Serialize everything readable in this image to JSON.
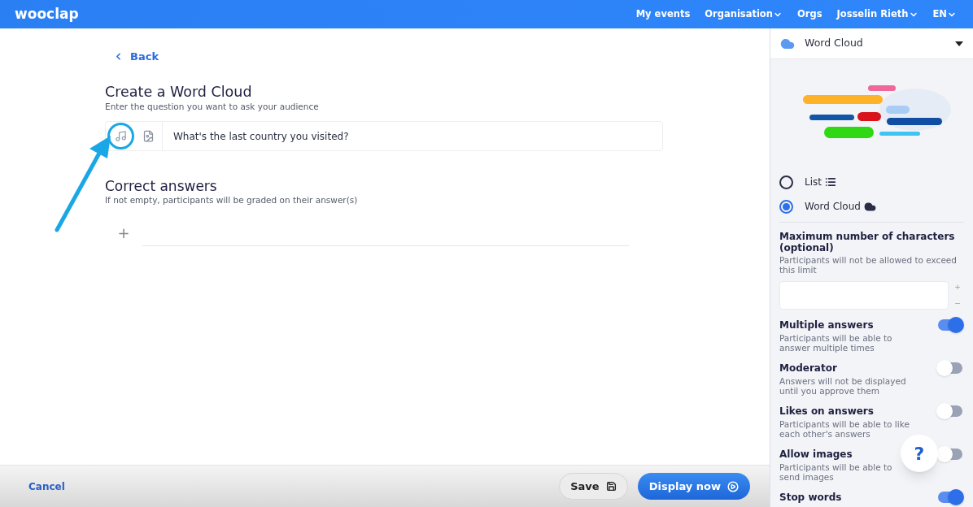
{
  "header": {
    "logo": "wooclap",
    "nav": [
      {
        "label": "My events",
        "dropdown": false
      },
      {
        "label": "Organisation",
        "dropdown": true
      },
      {
        "label": "Orgs",
        "dropdown": false
      },
      {
        "label": "Josselin Rieth",
        "dropdown": true
      },
      {
        "label": "EN",
        "dropdown": true
      }
    ]
  },
  "main": {
    "back": "Back",
    "title": "Create a Word Cloud",
    "subtitle": "Enter the question you want to ask your audience",
    "question": "What's the last country you visited?",
    "correct_title": "Correct answers",
    "correct_subtitle": "If not empty, participants will be graded on their answer(s)",
    "add_symbol": "+"
  },
  "footer": {
    "cancel": "Cancel",
    "save": "Save",
    "display": "Display now"
  },
  "sidebar": {
    "type_label": "Word Cloud",
    "display_options": [
      {
        "label": "List",
        "kind": "list",
        "selected": false
      },
      {
        "label": "Word Cloud",
        "kind": "cloud",
        "selected": true
      }
    ],
    "settings": [
      {
        "kind": "number",
        "title": "Maximum number of characters (optional)",
        "description": "Participants will not be allowed to exceed this limit",
        "plus": "+",
        "minus": "−"
      },
      {
        "kind": "toggle",
        "title": "Multiple answers",
        "description": "Participants will be able to answer multiple times",
        "on": true
      },
      {
        "kind": "toggle",
        "title": "Moderator",
        "description": "Answers will not be displayed until you approve them",
        "on": false
      },
      {
        "kind": "toggle",
        "title": "Likes on answers",
        "description": "Participants will be able to like each other's answers",
        "on": false
      },
      {
        "kind": "toggle",
        "title": "Allow images",
        "description": "Participants will be able to send images",
        "on": false
      },
      {
        "kind": "toggle",
        "title": "Stop words",
        "on": true
      }
    ],
    "help": "?"
  }
}
